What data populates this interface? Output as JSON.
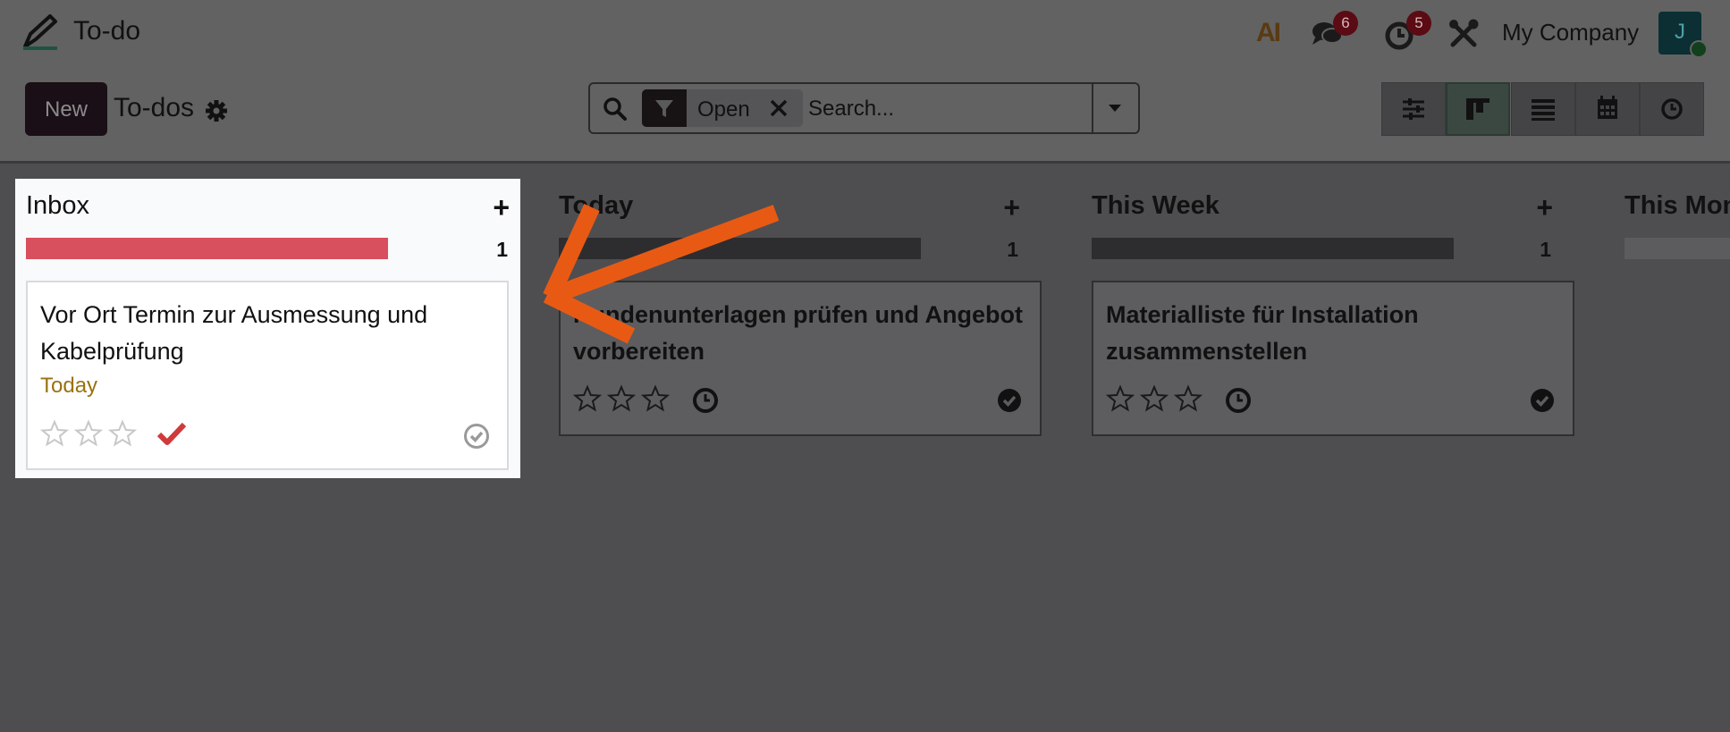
{
  "app": {
    "name": "To-do"
  },
  "navbar": {
    "ai_label": "AI",
    "messages_count": "6",
    "activities_count": "5",
    "company": "My Company",
    "avatar_initial": "J"
  },
  "control": {
    "new_label": "New",
    "title": "To-dos",
    "facet_label": "Open",
    "search_placeholder": "Search..."
  },
  "columns": [
    {
      "title": "Inbox",
      "count": "1",
      "progress": 1.0,
      "card": {
        "title": "Vor Ort Termin zur Ausmessung und Kabelprüfung",
        "date": "Today"
      }
    },
    {
      "title": "Today",
      "count": "1",
      "progress": 1.0,
      "card": {
        "title": "Kundenunterlagen prüfen und Angebot vorbereiten"
      }
    },
    {
      "title": "This Week",
      "count": "1",
      "progress": 1.0,
      "card": {
        "title": "Materialliste für Installation zusammenstellen"
      }
    },
    {
      "title": "This Month"
    }
  ],
  "colors": {
    "inbox_progress": "#d8505e",
    "deadline_today": "#9a7111",
    "check_mark": "#d03a3a",
    "annotation_arrow": "#e85a14"
  },
  "icons": [
    "pencil-icon",
    "chat-icon",
    "clock-icon",
    "tools-icon",
    "gear-icon",
    "search-icon",
    "filter-icon",
    "close-icon",
    "caret-down-icon",
    "settings-icon",
    "kanban-icon",
    "list-icon",
    "calendar-icon",
    "activity-icon",
    "star-icon",
    "check-icon",
    "done-icon",
    "plus-icon"
  ]
}
